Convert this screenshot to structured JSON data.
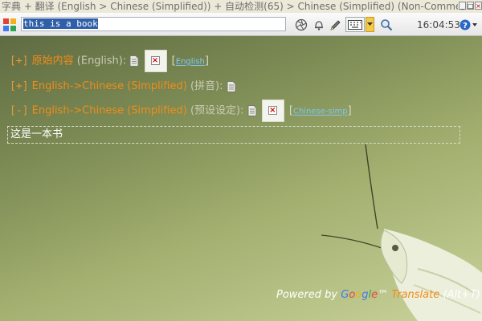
{
  "window": {
    "title": "字典 + 翻译 (English > Chinese (Simplified)) + 自动检测(65) > Chinese (Simplified) (Non-Commercial u",
    "buttons": {
      "minimize": "_",
      "maximize": "□",
      "close": "×"
    }
  },
  "toolbar": {
    "search_value": "this is a book",
    "clock": "16:04:53",
    "icons": [
      "app-logo-icon",
      "aperture-icon",
      "bell-icon",
      "pencil-icon",
      "keyboard-icon",
      "chevron-down-icon",
      "magnifier-icon",
      "help-icon"
    ]
  },
  "sections": [
    {
      "toggle": "[+]",
      "title": "原始内容",
      "lang_open": "(English):",
      "link": "English",
      "has_image": true
    },
    {
      "toggle": "[+]",
      "title": "English->Chinese (Simplified)",
      "lang_open": "(拼音):",
      "has_image": false
    },
    {
      "toggle": "[-]",
      "title": "English->Chinese (Simplified)",
      "lang_open": "(预设设定):",
      "link": "Chinese-simp",
      "has_image": true
    }
  ],
  "result": {
    "text": "这是一本书"
  },
  "footer": {
    "powered_by": "Powered by",
    "google_letters": [
      "G",
      "o",
      "o",
      "g",
      "l",
      "e"
    ],
    "tm": "™",
    "translate": "Translate",
    "shortcut": "(Alt+T)"
  },
  "colors": {
    "accent_orange": "#f08c1b",
    "link_blue": "#7fc7ef",
    "selection": "#2f5fa8"
  }
}
